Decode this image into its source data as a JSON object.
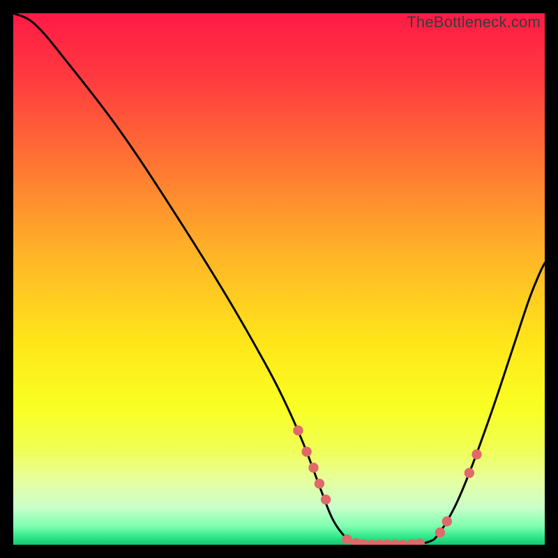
{
  "watermark": "TheBottleneck.com",
  "colors": {
    "dot": "#e06969",
    "curve": "#000000"
  },
  "chart_data": {
    "type": "line",
    "title": "",
    "xlabel": "",
    "ylabel": "",
    "xlim": [
      0,
      100
    ],
    "ylim": [
      0,
      100
    ],
    "curve": [
      {
        "x": 0,
        "y": 100
      },
      {
        "x": 4,
        "y": 98
      },
      {
        "x": 10,
        "y": 91
      },
      {
        "x": 20,
        "y": 78
      },
      {
        "x": 30,
        "y": 63
      },
      {
        "x": 40,
        "y": 47
      },
      {
        "x": 48,
        "y": 33
      },
      {
        "x": 52,
        "y": 25
      },
      {
        "x": 55,
        "y": 18
      },
      {
        "x": 58,
        "y": 10
      },
      {
        "x": 60,
        "y": 5
      },
      {
        "x": 62,
        "y": 2
      },
      {
        "x": 64,
        "y": 0.5
      },
      {
        "x": 68,
        "y": 0
      },
      {
        "x": 74,
        "y": 0
      },
      {
        "x": 78,
        "y": 0.5
      },
      {
        "x": 80,
        "y": 2
      },
      {
        "x": 83,
        "y": 7
      },
      {
        "x": 86,
        "y": 14
      },
      {
        "x": 90,
        "y": 25
      },
      {
        "x": 94,
        "y": 37
      },
      {
        "x": 97,
        "y": 46
      },
      {
        "x": 99,
        "y": 51
      },
      {
        "x": 100,
        "y": 53
      }
    ],
    "points": [
      {
        "x": 53.6,
        "y": 21.5
      },
      {
        "x": 55.2,
        "y": 17.5
      },
      {
        "x": 56.5,
        "y": 14.5
      },
      {
        "x": 57.6,
        "y": 11.5
      },
      {
        "x": 58.8,
        "y": 8.5
      },
      {
        "x": 62.8,
        "y": 1.0
      },
      {
        "x": 64.5,
        "y": 0.3
      },
      {
        "x": 65.8,
        "y": 0.1
      },
      {
        "x": 67.5,
        "y": 0.0
      },
      {
        "x": 69.0,
        "y": 0.0
      },
      {
        "x": 70.3,
        "y": 0.0
      },
      {
        "x": 71.8,
        "y": 0.0
      },
      {
        "x": 73.3,
        "y": 0.0
      },
      {
        "x": 75.0,
        "y": 0.1
      },
      {
        "x": 76.5,
        "y": 0.2
      },
      {
        "x": 80.3,
        "y": 2.3
      },
      {
        "x": 81.6,
        "y": 4.4
      },
      {
        "x": 85.8,
        "y": 13.5
      },
      {
        "x": 87.2,
        "y": 17.0
      }
    ],
    "gradient_stops": [
      {
        "offset": 0.0,
        "color": "#ff1a46"
      },
      {
        "offset": 0.12,
        "color": "#ff3a3f"
      },
      {
        "offset": 0.28,
        "color": "#ff7433"
      },
      {
        "offset": 0.45,
        "color": "#ffb327"
      },
      {
        "offset": 0.62,
        "color": "#ffe61a"
      },
      {
        "offset": 0.74,
        "color": "#f9ff22"
      },
      {
        "offset": 0.82,
        "color": "#f0ff55"
      },
      {
        "offset": 0.88,
        "color": "#e6ffa0"
      },
      {
        "offset": 0.93,
        "color": "#c8ffca"
      },
      {
        "offset": 0.965,
        "color": "#7fffb0"
      },
      {
        "offset": 0.985,
        "color": "#30e88a"
      },
      {
        "offset": 1.0,
        "color": "#16c66e"
      }
    ]
  }
}
